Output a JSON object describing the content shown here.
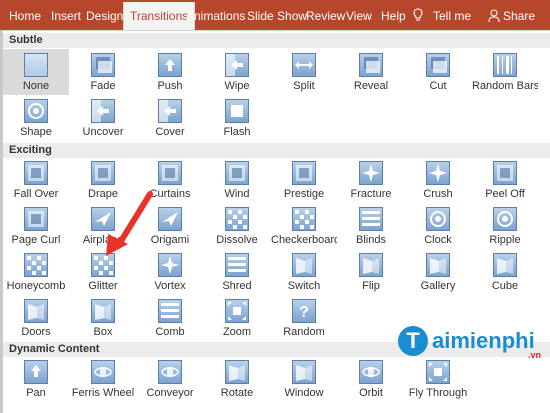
{
  "ribbon": {
    "tabs": [
      {
        "label": "Home",
        "active": false
      },
      {
        "label": "Insert",
        "active": false
      },
      {
        "label": "Design",
        "active": false
      },
      {
        "label": "Transitions",
        "active": true
      },
      {
        "label": "Animations",
        "active": false
      },
      {
        "label": "Slide Show",
        "active": false
      },
      {
        "label": "Review",
        "active": false
      },
      {
        "label": "View",
        "active": false
      },
      {
        "label": "Help",
        "active": false
      }
    ],
    "tell_me": "Tell me",
    "share": "Share",
    "color": "#b7472a"
  },
  "sections": [
    {
      "title": "Subtle",
      "items": [
        {
          "label": "None",
          "icon": "none-icon",
          "selected": true
        },
        {
          "label": "Fade",
          "icon": "fade-icon"
        },
        {
          "label": "Push",
          "icon": "push-icon"
        },
        {
          "label": "Wipe",
          "icon": "wipe-icon"
        },
        {
          "label": "Split",
          "icon": "split-icon"
        },
        {
          "label": "Reveal",
          "icon": "reveal-icon"
        },
        {
          "label": "Cut",
          "icon": "cut-icon"
        },
        {
          "label": "Random Bars",
          "icon": "random-bars-icon"
        },
        {
          "label": "Shape",
          "icon": "shape-icon"
        },
        {
          "label": "Uncover",
          "icon": "uncover-icon"
        },
        {
          "label": "Cover",
          "icon": "cover-icon"
        },
        {
          "label": "Flash",
          "icon": "flash-icon"
        }
      ]
    },
    {
      "title": "Exciting",
      "items": [
        {
          "label": "Fall Over",
          "icon": "fall-over-icon"
        },
        {
          "label": "Drape",
          "icon": "drape-icon"
        },
        {
          "label": "Curtains",
          "icon": "curtains-icon"
        },
        {
          "label": "Wind",
          "icon": "wind-icon"
        },
        {
          "label": "Prestige",
          "icon": "prestige-icon"
        },
        {
          "label": "Fracture",
          "icon": "fracture-icon"
        },
        {
          "label": "Crush",
          "icon": "crush-icon"
        },
        {
          "label": "Peel Off",
          "icon": "peel-off-icon"
        },
        {
          "label": "Page Curl",
          "icon": "page-curl-icon"
        },
        {
          "label": "Airplane",
          "icon": "airplane-icon"
        },
        {
          "label": "Origami",
          "icon": "origami-icon"
        },
        {
          "label": "Dissolve",
          "icon": "dissolve-icon"
        },
        {
          "label": "Checkerboard",
          "icon": "checkerboard-icon"
        },
        {
          "label": "Blinds",
          "icon": "blinds-icon"
        },
        {
          "label": "Clock",
          "icon": "clock-icon"
        },
        {
          "label": "Ripple",
          "icon": "ripple-icon"
        },
        {
          "label": "Honeycomb",
          "icon": "honeycomb-icon"
        },
        {
          "label": "Glitter",
          "icon": "glitter-icon"
        },
        {
          "label": "Vortex",
          "icon": "vortex-icon"
        },
        {
          "label": "Shred",
          "icon": "shred-icon"
        },
        {
          "label": "Switch",
          "icon": "switch-icon"
        },
        {
          "label": "Flip",
          "icon": "flip-icon"
        },
        {
          "label": "Gallery",
          "icon": "gallery-icon"
        },
        {
          "label": "Cube",
          "icon": "cube-icon"
        },
        {
          "label": "Doors",
          "icon": "doors-icon"
        },
        {
          "label": "Box",
          "icon": "box-icon"
        },
        {
          "label": "Comb",
          "icon": "comb-icon"
        },
        {
          "label": "Zoom",
          "icon": "zoom-icon"
        },
        {
          "label": "Random",
          "icon": "random-icon"
        }
      ]
    },
    {
      "title": "Dynamic Content",
      "items": [
        {
          "label": "Pan",
          "icon": "pan-icon"
        },
        {
          "label": "Ferris Wheel",
          "icon": "ferris-wheel-icon"
        },
        {
          "label": "Conveyor",
          "icon": "conveyor-icon"
        },
        {
          "label": "Rotate",
          "icon": "rotate-icon"
        },
        {
          "label": "Window",
          "icon": "window-icon"
        },
        {
          "label": "Orbit",
          "icon": "orbit-icon"
        },
        {
          "label": "Fly Through",
          "icon": "fly-through-icon"
        }
      ]
    }
  ],
  "watermark": {
    "initial": "T",
    "text": "aimienphi",
    "suffix": ".vn"
  }
}
